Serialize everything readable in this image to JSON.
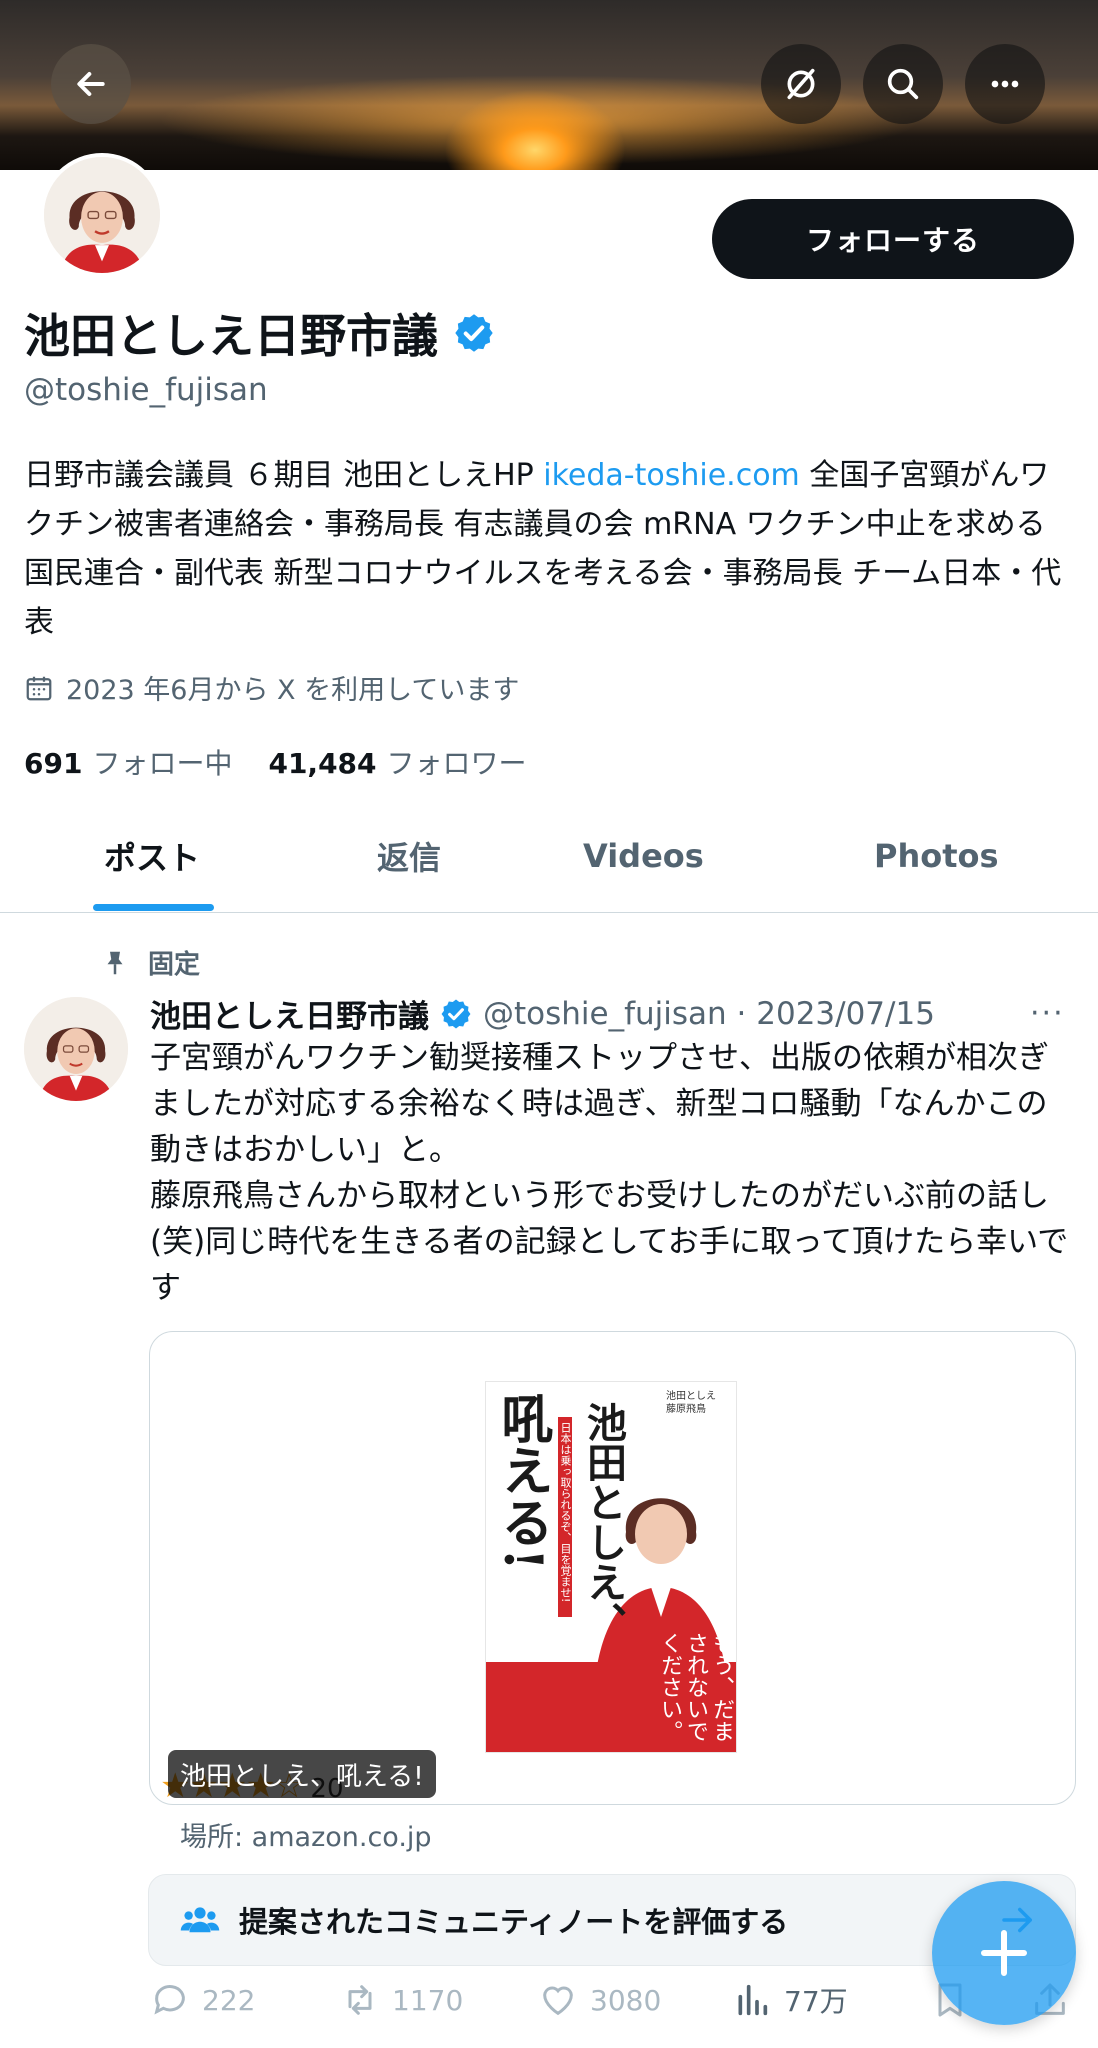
{
  "profile": {
    "follow_label": "フォローする",
    "name": "池田としえ日野市議",
    "handle": "@toshie_fujisan",
    "bio_part1": "日野市議会議員 ６期目 池田としえHP ",
    "bio_link": "ikeda-toshie.com",
    "bio_part2": " 全国子宮頸がんワクチン被害者連絡会・事務局長 有志議員の会 mRNA ワクチン中止を求める国民連合・副代表 新型コロナウイルスを考える会・事務局長 チーム日本・代表",
    "joined": "2023 年6月から X を利用しています",
    "following_count": "691",
    "following_label": "フォロー中",
    "followers_count": "41,484",
    "followers_label": "フォロワー"
  },
  "tabs": [
    {
      "label": "ポスト",
      "active": true
    },
    {
      "label": "返信",
      "active": false
    },
    {
      "label": "Videos",
      "active": false
    },
    {
      "label": "Photos",
      "active": false
    }
  ],
  "post": {
    "pinned_label": "固定",
    "author": "池田としえ日野市議",
    "handle_date": "@toshie_fujisan · 2023/07/15",
    "more": "···",
    "text": "子宮頸がんワクチン勧奨接種ストップさせ、出版の依頼が相次ぎましたが対応する余裕なく時は過ぎ、新型コロ騒動「なんかこの動きはおかしい」と。\n藤原飛鳥さんから取材という形でお受けしたのがだいぶ前の話し(笑)同じ時代を生きる者の記録としてお手に取って頂けたら幸いです",
    "card_title": "池田としえ、吼える!",
    "rating_stars": "★★★★☆",
    "rating_count": "20",
    "card_source": "場所: amazon.co.jp",
    "book": {
      "title": "池田としえ、",
      "title2": "吼える!",
      "authors": "池田としえ\n藤原飛鳥",
      "tagline": "日本は乗っ取られるぞ、目を覚ませ!",
      "banner": "もう、だまされないでください。"
    }
  },
  "community_note": "提案されたコミュニティノートを評価する",
  "actions": {
    "replies": "222",
    "reposts": "1170",
    "likes": "3080",
    "views": "77万"
  },
  "colors": {
    "accent": "#1d9bf0",
    "text": "#0f1419",
    "muted": "#536471"
  }
}
